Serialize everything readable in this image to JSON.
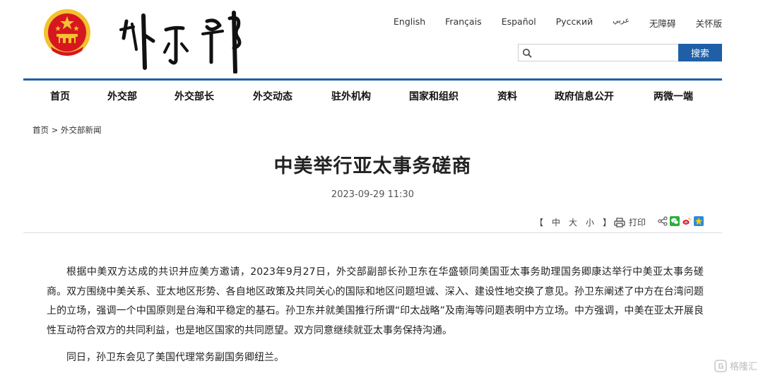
{
  "header": {
    "languages": [
      "English",
      "Français",
      "Español",
      "Русский",
      "عربي",
      "无障碍",
      "关怀版"
    ],
    "search": {
      "placeholder": "",
      "button_label": "搜索"
    }
  },
  "nav": {
    "items": [
      "首页",
      "外交部",
      "外交部长",
      "外交动态",
      "驻外机构",
      "国家和组织",
      "资料",
      "政府信息公开",
      "两微一端"
    ]
  },
  "breadcrumb": {
    "home": "首页",
    "separator": ">",
    "section": "外交部新闻"
  },
  "article": {
    "title": "中美举行亚太事务磋商",
    "date": "2023-09-29 11:30",
    "paragraphs": [
      "根据中美双方达成的共识并应美方邀请，2023年9月27日，外交部副部长孙卫东在华盛顿同美国亚太事务助理国务卿康达举行中美亚太事务磋商。双方围绕中美关系、亚太地区形势、各自地区政策及共同关心的国际和地区问题坦诚、深入、建设性地交换了意见。孙卫东阐述了中方在台湾问题上的立场，强调一个中国原则是台海和平稳定的基石。孙卫东并就美国推行所谓“印太战略”及南海等问题表明中方立场。中方强调，中美在亚太开展良性互动符合双方的共同利益，也是地区国家的共同愿望。双方同意继续就亚太事务保持沟通。",
      "同日，孙卫东会见了美国代理常务副国务卿纽兰。"
    ]
  },
  "tools": {
    "font_open": "【",
    "font_large": "中",
    "font_medium": "大",
    "font_small": "小",
    "font_close": "】",
    "print_label": "打印"
  },
  "watermark": {
    "text": "格隆汇"
  },
  "colors": {
    "brand_blue": "#1e5fa8",
    "emblem_red": "#d7171f",
    "emblem_gold": "#f2c230"
  }
}
